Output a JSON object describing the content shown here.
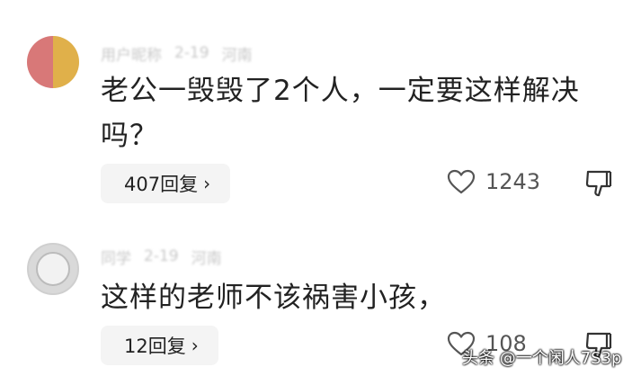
{
  "comments": [
    {
      "meta": [
        "用户昵称",
        "2-19",
        "河南"
      ],
      "text_line1": "老公一毁毁了2个人，一定要这样解决",
      "text_line2": "吗？",
      "reply_label": "407回复",
      "like_count": "1243",
      "chevron": "›"
    },
    {
      "meta": [
        "同学",
        "2-19",
        "河南"
      ],
      "text_line1": "这样的老师不该祸害小孩，",
      "reply_label": "12回复",
      "like_count": "108",
      "chevron": "›"
    }
  ],
  "watermark": "头条 @一个闲人7S3p",
  "icons": {
    "like": "heart-outline-icon",
    "dislike": "thumbs-down-outline-icon",
    "chevron": "chevron-right-icon"
  },
  "colors": {
    "text": "#222222",
    "muted": "#555555",
    "button_bg": "#f4f4f4"
  }
}
